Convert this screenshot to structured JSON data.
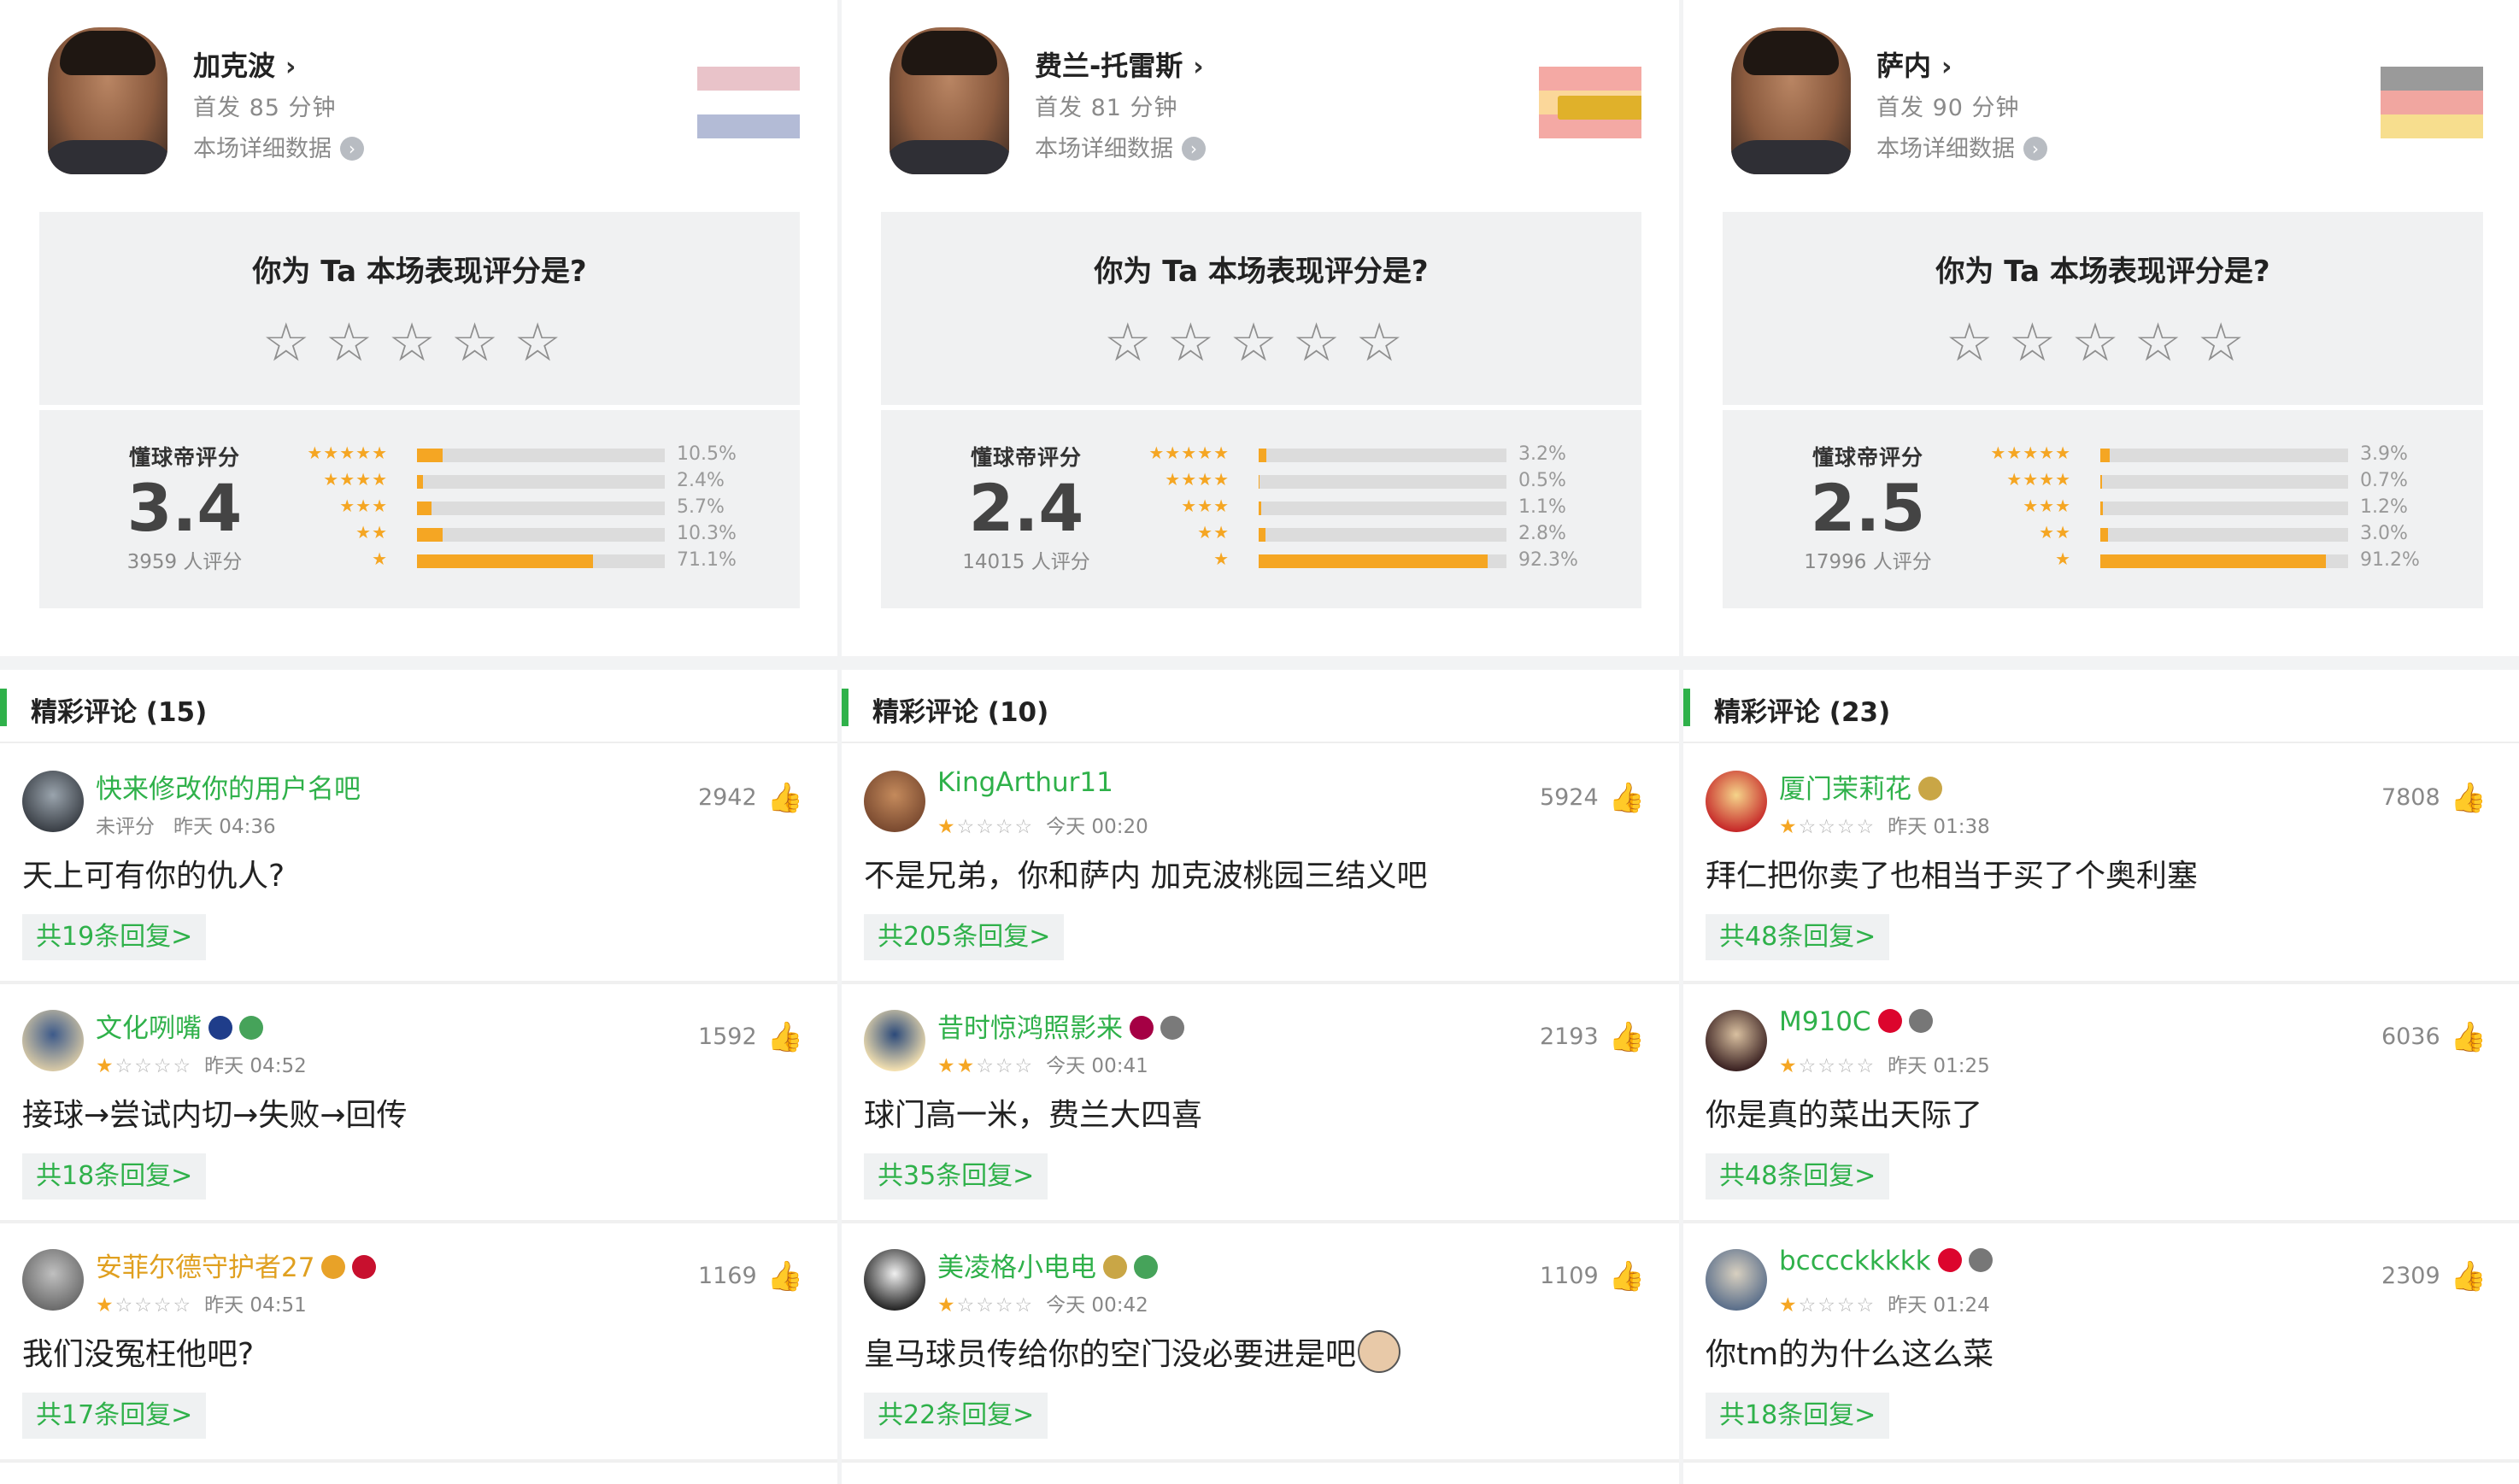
{
  "labels": {
    "rating_question": "你为 Ta 本场表现评分是?",
    "score_label": "懂球帝评分",
    "detail_link": "本场详细数据",
    "star_glyph": "☆",
    "like_glyph": "👍"
  },
  "colors": {
    "accent_green": "#2fb14a",
    "star_orange": "#f5a623",
    "bar_bg": "#dcdcdc"
  },
  "panels": [
    {
      "player": {
        "name": "加克波",
        "minutes": "首发 85 分钟",
        "flag": [
          "#e9c3c9",
          "#ffffff",
          "#b3bbd6"
        ]
      },
      "rating": {
        "score": "3.4",
        "count": "3959 人评分",
        "distribution": [
          {
            "stars": "★★★★★",
            "pct": "10.5%",
            "value": 10.5
          },
          {
            "stars": "★★★★",
            "pct": "2.4%",
            "value": 2.4
          },
          {
            "stars": "★★★",
            "pct": "5.7%",
            "value": 5.7
          },
          {
            "stars": "★★",
            "pct": "10.3%",
            "value": 10.3
          },
          {
            "stars": "★",
            "pct": "71.1%",
            "value": 71.1
          }
        ]
      },
      "comments_title": "精彩评论 (15)",
      "comments": [
        {
          "user": "快来修改你的用户名吧",
          "user_color": "#2fb14a",
          "rating": 0,
          "rating_text": "未评分",
          "time": "昨天 04:36",
          "likes": "2942",
          "text": "天上可有你的仇人?",
          "replies": "共19条回复>",
          "badges": []
        },
        {
          "user": "文化咧嘴",
          "user_color": "#2fb14a",
          "rating": 1,
          "rating_text": "",
          "time": "昨天 04:52",
          "likes": "1592",
          "text": "接球→尝试内切→失败→回传",
          "replies": "共18条回复>",
          "badges": [
            {
              "name": "club-badge-blue-icon",
              "color": "#1f3d8a"
            },
            {
              "name": "clover-badge-icon",
              "color": "#46a35a"
            }
          ]
        },
        {
          "user": "安菲尔德守护者27",
          "user_color": "#e0a020",
          "rating": 1,
          "rating_text": "",
          "time": "昨天 04:51",
          "likes": "1169",
          "text": "我们没冤枉他吧?",
          "replies": "共17条回复>",
          "badges": [
            {
              "name": "diamond-badge-icon",
              "color": "#e8a228"
            },
            {
              "name": "liverbird-badge-icon",
              "color": "#c8102e"
            }
          ]
        }
      ]
    },
    {
      "player": {
        "name": "费兰-托雷斯",
        "minutes": "首发 81 分钟",
        "flag": [
          "#f4a9a4",
          "#fbd79a",
          "#f4a9a4"
        ]
      },
      "rating": {
        "score": "2.4",
        "count": "14015 人评分",
        "distribution": [
          {
            "stars": "★★★★★",
            "pct": "3.2%",
            "value": 3.2
          },
          {
            "stars": "★★★★",
            "pct": "0.5%",
            "value": 0.5
          },
          {
            "stars": "★★★",
            "pct": "1.1%",
            "value": 1.1
          },
          {
            "stars": "★★",
            "pct": "2.8%",
            "value": 2.8
          },
          {
            "stars": "★",
            "pct": "92.3%",
            "value": 92.3
          }
        ]
      },
      "comments_title": "精彩评论 (10)",
      "comments": [
        {
          "user": "KingArthur11",
          "user_color": "#2fb14a",
          "rating": 1,
          "rating_text": "",
          "time": "今天 00:20",
          "likes": "5924",
          "text": "不是兄弟，你和萨内 加克波桃园三结义吧",
          "replies": "共205条回复>",
          "badges": []
        },
        {
          "user": "昔时惊鸿照影来",
          "user_color": "#2fb14a",
          "rating": 2,
          "rating_text": "",
          "time": "今天 00:41",
          "likes": "2193",
          "text": "球门高一米，费兰大四喜",
          "replies": "共35条回复>",
          "badges": [
            {
              "name": "barcelona-badge-icon",
              "color": "#a50044"
            },
            {
              "name": "trophy-badge-icon",
              "color": "#7a7a7a"
            }
          ]
        },
        {
          "user": "美凌格小电电",
          "user_color": "#2fb14a",
          "rating": 1,
          "rating_text": "",
          "time": "今天 00:42",
          "likes": "1109",
          "text": "皇马球员传给你的空门没必要进是吧",
          "replies": "共22条回复>",
          "badges": [
            {
              "name": "realmadrid-badge-icon",
              "color": "#c9a646"
            },
            {
              "name": "clover-badge-icon",
              "color": "#46a35a"
            }
          ]
        }
      ]
    },
    {
      "player": {
        "name": "萨内",
        "minutes": "首发 90 分钟",
        "flag": [
          "#9a9a9a",
          "#f1a6a0",
          "#f7de8e"
        ]
      },
      "rating": {
        "score": "2.5",
        "count": "17996 人评分",
        "distribution": [
          {
            "stars": "★★★★★",
            "pct": "3.9%",
            "value": 3.9
          },
          {
            "stars": "★★★★",
            "pct": "0.7%",
            "value": 0.7
          },
          {
            "stars": "★★★",
            "pct": "1.2%",
            "value": 1.2
          },
          {
            "stars": "★★",
            "pct": "3.0%",
            "value": 3.0
          },
          {
            "stars": "★",
            "pct": "91.2%",
            "value": 91.2
          }
        ]
      },
      "comments_title": "精彩评论 (23)",
      "comments": [
        {
          "user": "厦门茉莉花",
          "user_color": "#2fb14a",
          "rating": 1,
          "rating_text": "",
          "time": "昨天 01:38",
          "likes": "7808",
          "text": "拜仁把你卖了也相当于买了个奥利塞",
          "replies": "共48条回复>",
          "badges": [
            {
              "name": "realmadrid-badge-icon",
              "color": "#c9a646"
            }
          ]
        },
        {
          "user": "M910C",
          "user_color": "#2fb14a",
          "rating": 1,
          "rating_text": "",
          "time": "昨天 01:25",
          "likes": "6036",
          "text": "你是真的菜出天际了",
          "replies": "共48条回复>",
          "badges": [
            {
              "name": "bayern-badge-icon",
              "color": "#dc052d"
            },
            {
              "name": "ball-badge-icon",
              "color": "#777777"
            }
          ]
        },
        {
          "user": "bcccckkkkk",
          "user_color": "#2fb14a",
          "rating": 1,
          "rating_text": "",
          "time": "昨天 01:24",
          "likes": "2309",
          "text": "你tm的为什么这么菜",
          "replies": "共18条回复>",
          "badges": [
            {
              "name": "bayern-badge-icon",
              "color": "#dc052d"
            },
            {
              "name": "ball-badge-icon",
              "color": "#777777"
            }
          ]
        }
      ]
    }
  ]
}
